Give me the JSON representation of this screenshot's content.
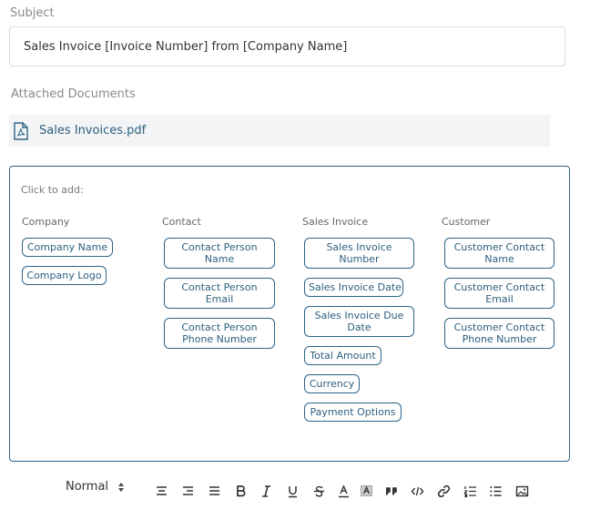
{
  "subject": {
    "label": "Subject",
    "value": "Sales Invoice [Invoice Number] from [Company Name]"
  },
  "attachments": {
    "label": "Attached Documents",
    "files": [
      {
        "name": "Sales Invoices.pdf",
        "icon": "pdf-file-icon"
      }
    ]
  },
  "placeholders": {
    "hint": "Click to add:",
    "columns": [
      {
        "title": "Company",
        "items": [
          "Company Name",
          "Company Logo"
        ]
      },
      {
        "title": "Contact",
        "items": [
          "Contact Person Name",
          "Contact Person Email",
          "Contact Person Phone Number"
        ]
      },
      {
        "title": "Sales Invoice",
        "items": [
          "Sales Invoice Number",
          "Sales Invoice Date",
          "Sales Invoice Due Date",
          "Total Amount",
          "Currency",
          "Payment Options"
        ]
      },
      {
        "title": "Customer",
        "items": [
          "Customer Contact Name",
          "Customer Contact Email",
          "Customer Contact Phone Number"
        ]
      }
    ]
  },
  "toolbar": {
    "format_value": "Normal",
    "buttons": [
      "align-center-icon",
      "align-right-icon",
      "align-justify-icon",
      "bold-icon",
      "italic-icon",
      "underline-icon",
      "strikethrough-icon",
      "text-color-icon",
      "background-color-icon",
      "blockquote-icon",
      "code-icon",
      "link-icon",
      "ordered-list-icon",
      "bullet-list-icon",
      "image-icon"
    ]
  },
  "colors": {
    "accent": "#2d6388",
    "link": "#2d5f7e",
    "attachment_bg": "#f2f4f5"
  }
}
